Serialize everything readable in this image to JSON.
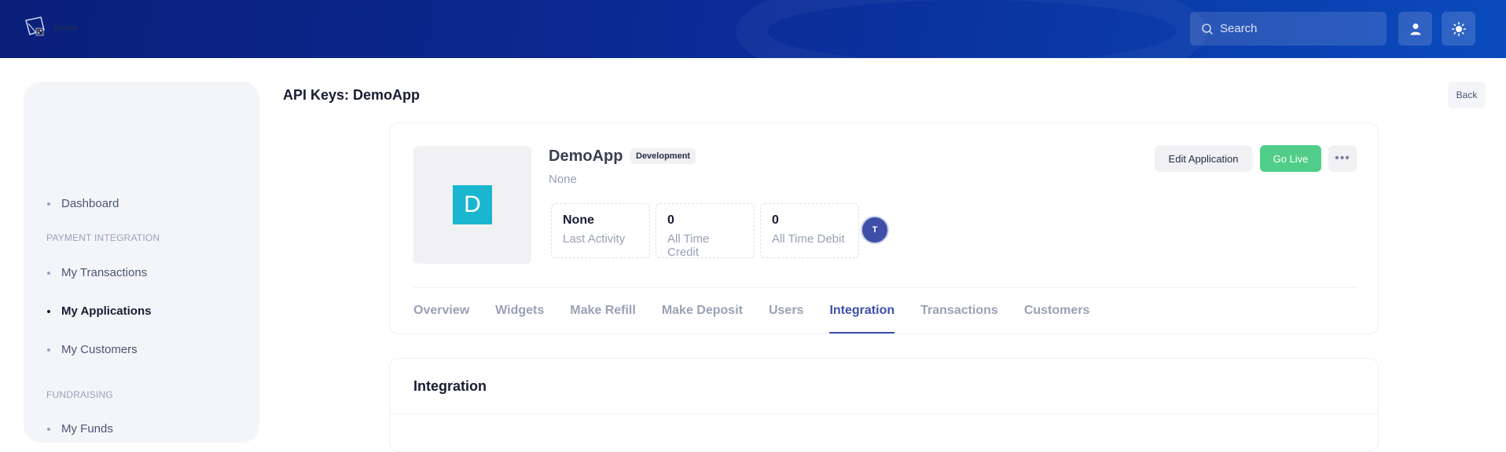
{
  "header": {
    "logo_text": "Somb",
    "search_placeholder": "Search",
    "icons": [
      "search-icon",
      "user-icon",
      "sun-icon"
    ]
  },
  "sidebar": {
    "items": [
      {
        "label": "Dashboard",
        "active": false
      },
      {
        "section": "PAYMENT INTEGRATION"
      },
      {
        "label": "My Transactions",
        "active": false
      },
      {
        "label": "My Applications",
        "active": true
      },
      {
        "label": "My Customers",
        "active": false
      },
      {
        "section": "FUNDRAISING"
      },
      {
        "label": "My Funds",
        "active": false
      }
    ]
  },
  "page": {
    "title": "API Keys: DemoApp",
    "back_label": "Back"
  },
  "app": {
    "avatar_letter": "D",
    "name": "DemoApp",
    "environment": "Development",
    "description": "None",
    "stats": [
      {
        "value": "None",
        "label": "Last Activity"
      },
      {
        "value": "0",
        "label": "All Time Credit"
      },
      {
        "value": "0",
        "label": "All Time Debit"
      }
    ],
    "user_initial": "T",
    "edit_label": "Edit Application",
    "go_live_label": "Go Live",
    "more_label": "•••"
  },
  "tabs": [
    {
      "label": "Overview",
      "active": false
    },
    {
      "label": "Widgets",
      "active": false
    },
    {
      "label": "Make Refill",
      "active": false
    },
    {
      "label": "Make Deposit",
      "active": false
    },
    {
      "label": "Users",
      "active": false
    },
    {
      "label": "Integration",
      "active": true
    },
    {
      "label": "Transactions",
      "active": false
    },
    {
      "label": "Customers",
      "active": false
    }
  ],
  "integration": {
    "title": "Integration"
  },
  "colors": {
    "accent": "#3e4fa8",
    "success": "#50cd89",
    "avatar_bg": "#1ab6cf"
  }
}
